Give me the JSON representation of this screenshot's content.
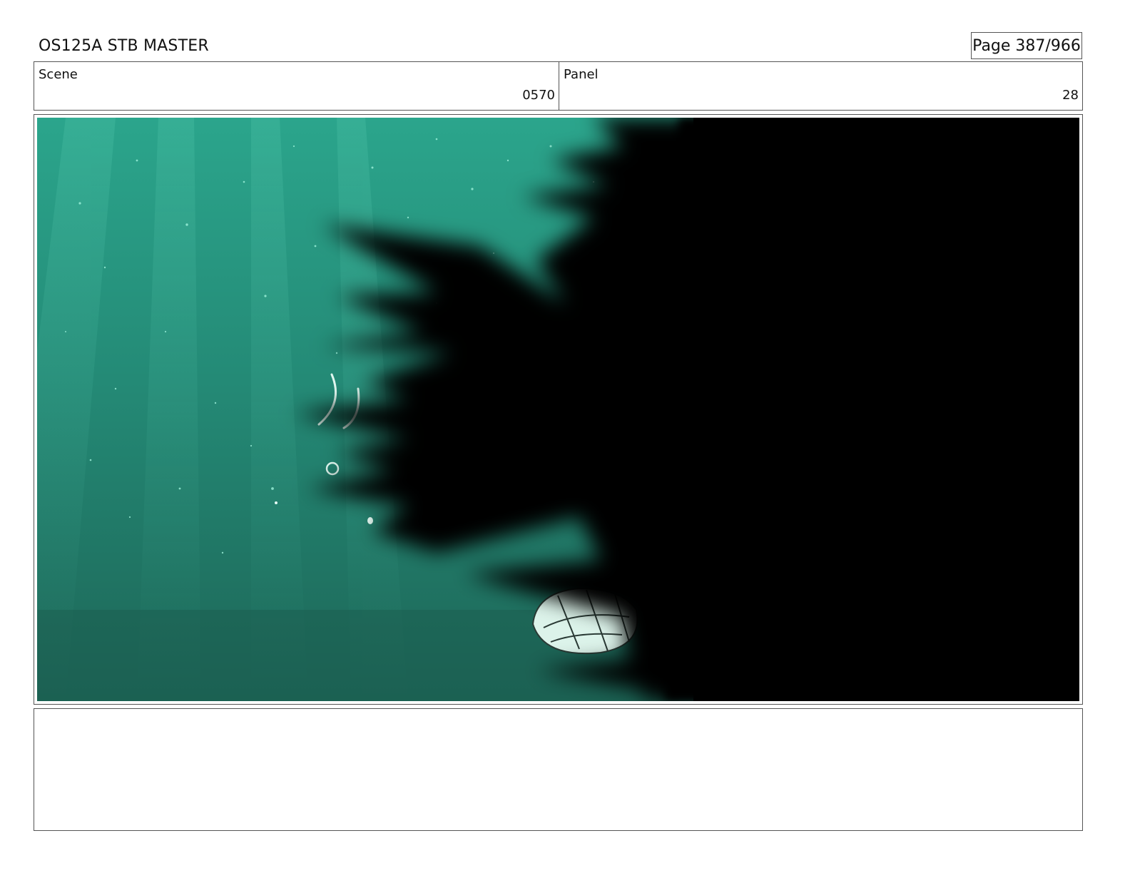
{
  "header": {
    "title": "OS125A STB MASTER",
    "page": "Page 387/966"
  },
  "info": {
    "scene_label": "Scene",
    "scene_value": "0570",
    "panel_label": "Panel",
    "panel_value": "28"
  },
  "frame": {
    "water_color": "#2a9c86",
    "shadow_color": "#000000"
  },
  "notes": {
    "text": ""
  }
}
